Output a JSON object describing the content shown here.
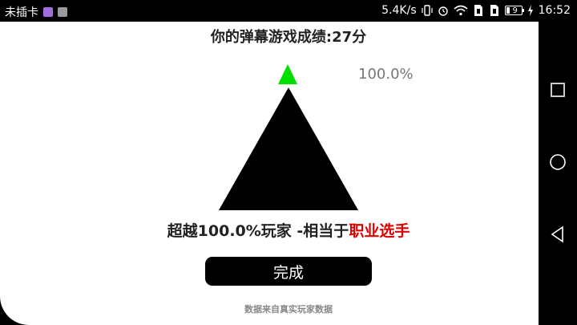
{
  "status_bar": {
    "carrier": "未插卡",
    "speed": "5.4K/s",
    "battery_level": "9",
    "time": "16:52"
  },
  "game": {
    "score_title": "你的弹幕游戏成绩:27分",
    "percent_label": "100.0%",
    "percentile_fill": 1.0,
    "result_prefix": "超越100.0%玩家 -相当于",
    "result_rank": "职业选手",
    "done_label": "完成",
    "footnote": "数据来自真实玩家数据",
    "marker_color": "#00e000",
    "rank_color": "#e00000"
  }
}
